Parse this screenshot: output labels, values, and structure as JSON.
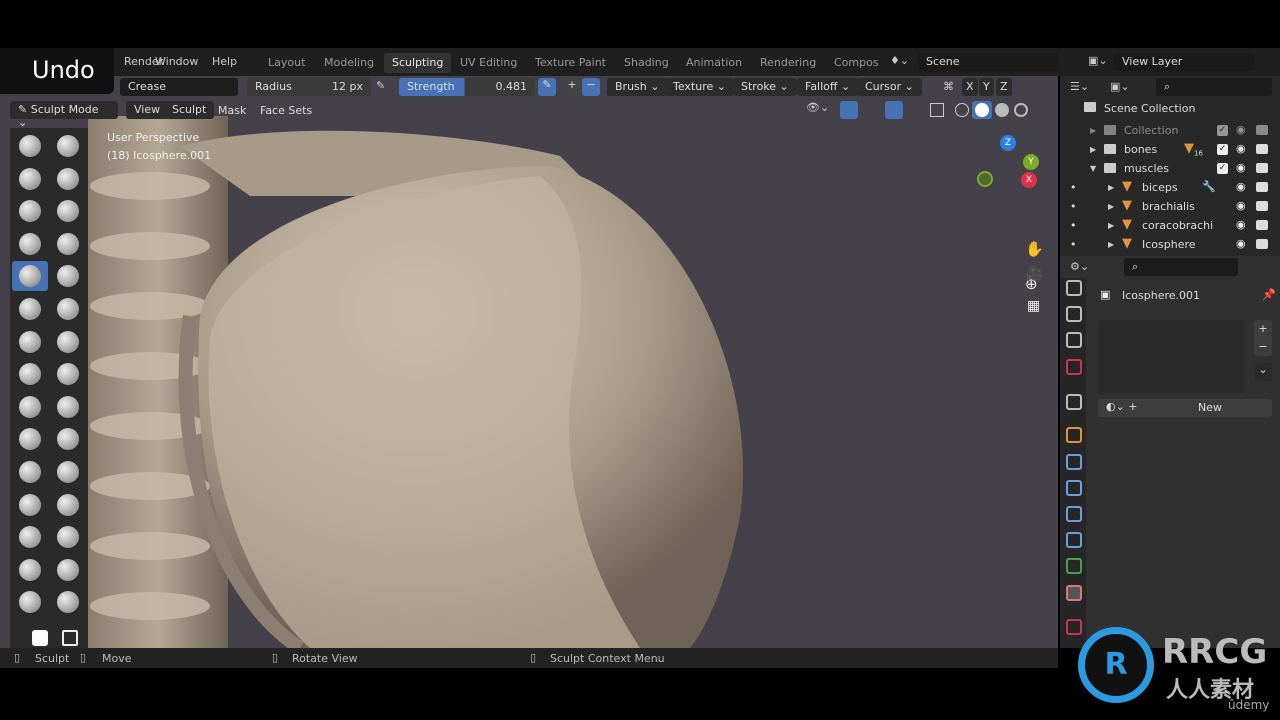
{
  "overlay": {
    "undo": "Undo"
  },
  "menu": [
    "Render",
    "Window",
    "Help"
  ],
  "workspaces": [
    {
      "label": "Layout"
    },
    {
      "label": "Modeling"
    },
    {
      "label": "Sculpting",
      "active": true
    },
    {
      "label": "UV Editing"
    },
    {
      "label": "Texture Paint"
    },
    {
      "label": "Shading"
    },
    {
      "label": "Animation"
    },
    {
      "label": "Rendering"
    },
    {
      "label": "Compos"
    }
  ],
  "scene": {
    "label": "Scene"
  },
  "view_layer": {
    "label": "View Layer"
  },
  "tool_header": {
    "brush_name": "Crease",
    "radius_label": "Radius",
    "radius_value": "12 px",
    "strength_label": "Strength",
    "strength_value": "0.481",
    "dropdowns": [
      "Brush",
      "Texture",
      "Stroke",
      "Falloff",
      "Cursor"
    ],
    "axes": [
      "X",
      "Y",
      "Z"
    ]
  },
  "viewport_header": {
    "mode": "Sculpt Mode",
    "menus": [
      "View",
      "Sculpt",
      "Mask",
      "Face Sets"
    ]
  },
  "viewport": {
    "perspective": "User Perspective",
    "object": "(18) Icosphere.001",
    "gizmo_axes": [
      "X",
      "Y",
      "Z"
    ]
  },
  "outliner": {
    "root": "Scene Collection",
    "items": [
      {
        "label": "Collection",
        "type": "collection",
        "dim": true
      },
      {
        "label": "bones",
        "type": "collection",
        "badge": "16"
      },
      {
        "label": "muscles",
        "type": "collection",
        "expanded": true
      },
      {
        "label": "biceps",
        "type": "mesh",
        "modifier": true
      },
      {
        "label": "brachialis",
        "type": "mesh"
      },
      {
        "label": "coracobrachi",
        "type": "mesh"
      },
      {
        "label": "Icosphere",
        "type": "mesh"
      }
    ]
  },
  "properties": {
    "object_name": "Icosphere.001",
    "new_button": "New"
  },
  "status_bar": {
    "items": [
      "Sculpt",
      "Move",
      "Rotate View",
      "Sculpt Context Menu"
    ]
  },
  "watermark": {
    "brand": "RRCG",
    "sub": "人人素材",
    "source": "ûdemy"
  },
  "colors": {
    "accent": "#4772b3",
    "mesh": "#e0953c",
    "viewport_bg": "#44414a"
  }
}
